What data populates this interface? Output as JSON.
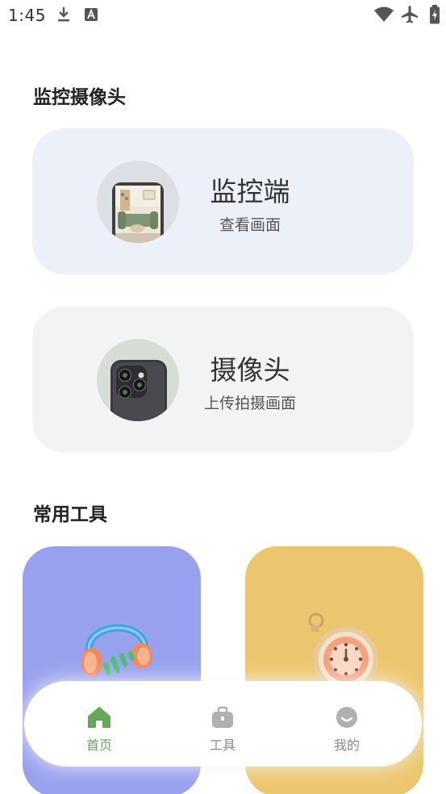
{
  "status_bar": {
    "time": "1:45"
  },
  "sections": {
    "camera_title": "监控摄像头",
    "tools_title": "常用工具"
  },
  "cards": {
    "monitor": {
      "title": "监控端",
      "subtitle": "查看画面"
    },
    "camera": {
      "title": "摄像头",
      "subtitle": "上传拍摄画面"
    }
  },
  "tool_cards": [
    {
      "icon": "headphones-icon",
      "color": "#98A1EE"
    },
    {
      "icon": "stopwatch-icon",
      "color": "#ECC66E"
    }
  ],
  "bottom_nav": {
    "items": [
      {
        "label": "首页",
        "icon": "home-icon",
        "active": true
      },
      {
        "label": "工具",
        "icon": "toolbox-icon",
        "active": false
      },
      {
        "label": "我的",
        "icon": "profile-icon",
        "active": false
      }
    ],
    "active_color": "#67A75B",
    "inactive_color": "#A9A9A9"
  }
}
